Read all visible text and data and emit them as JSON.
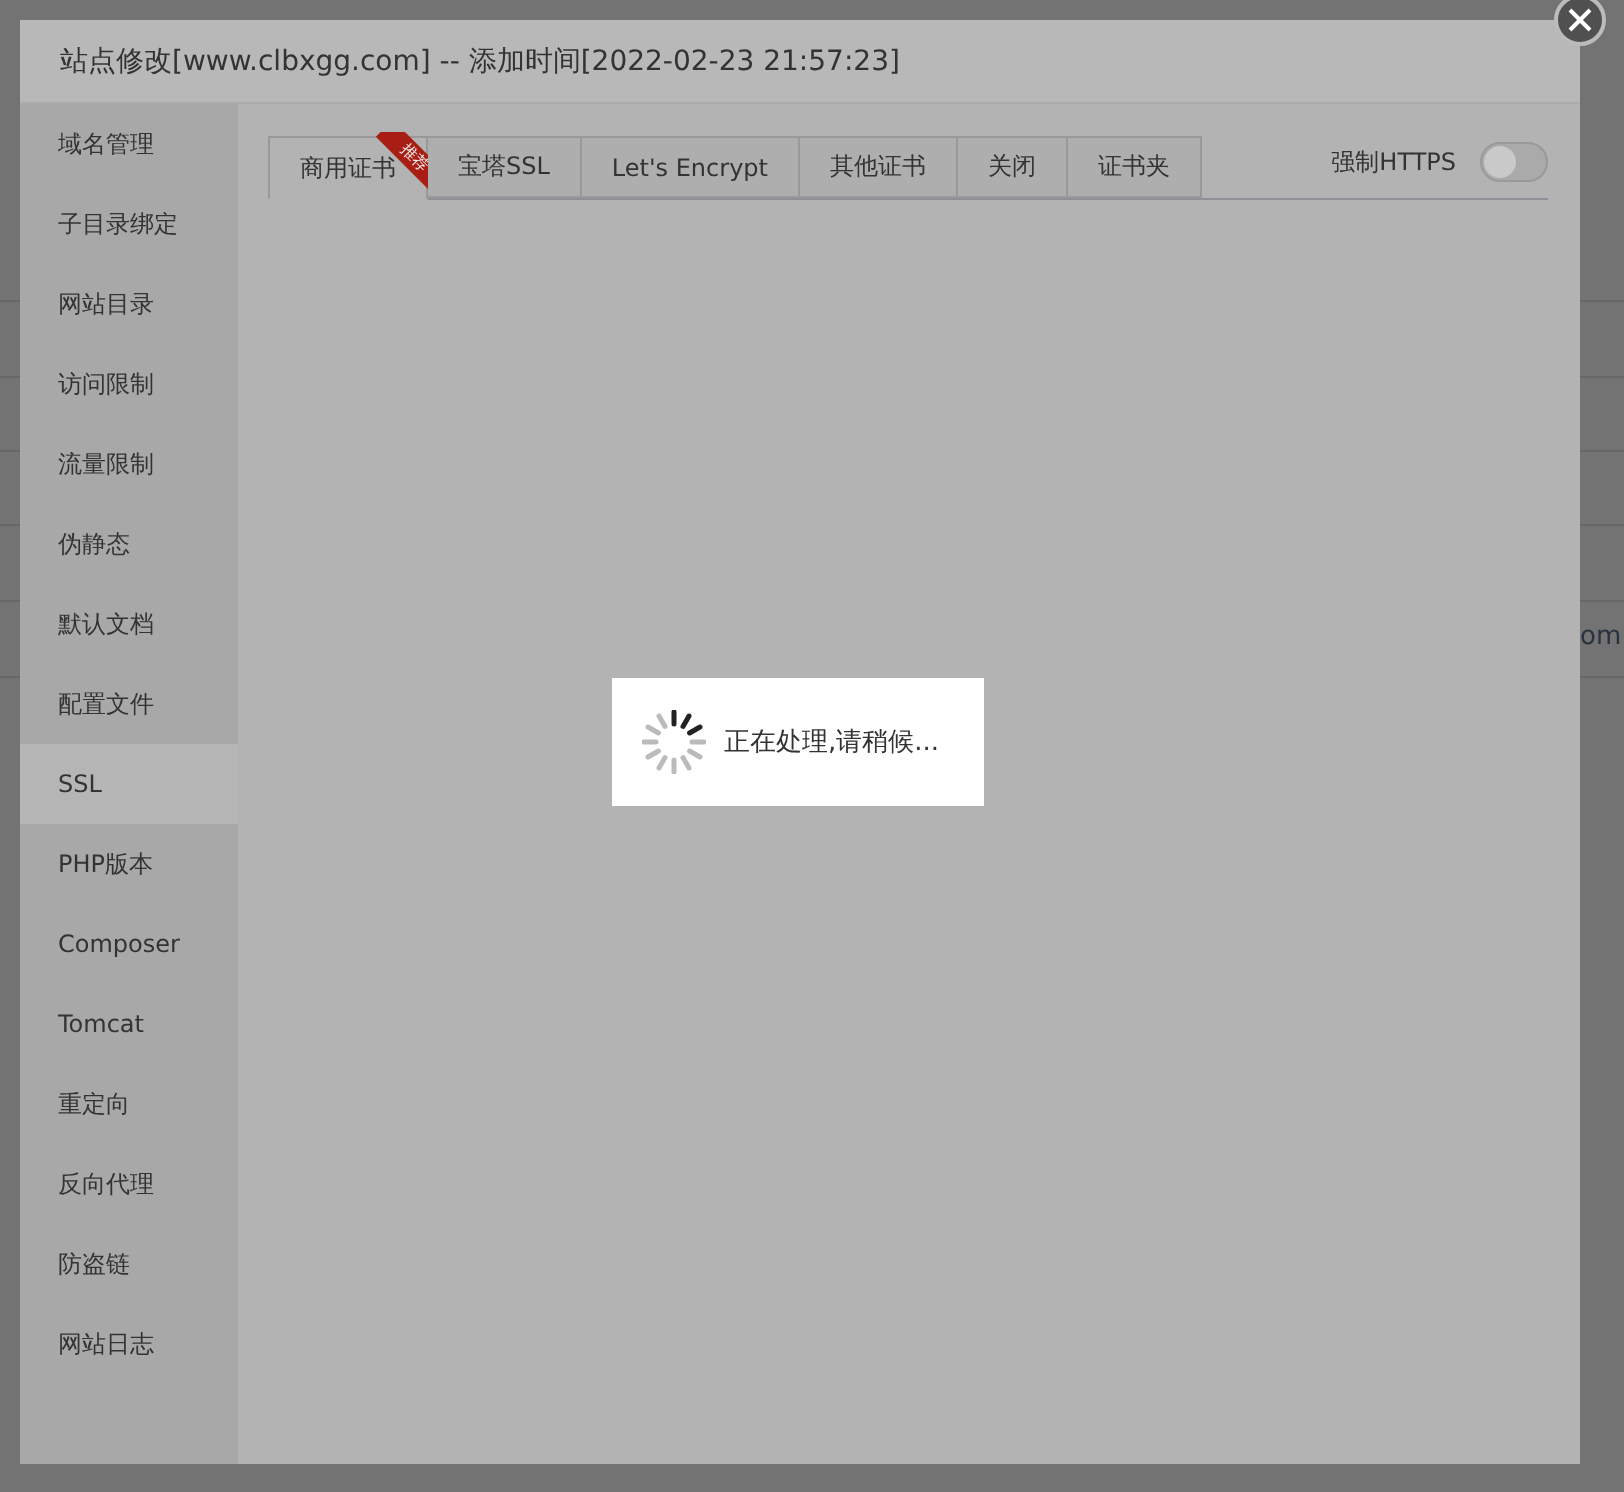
{
  "background": {
    "fragment": "om"
  },
  "dialog": {
    "title": "站点修改[www.clbxgg.com] -- 添加时间[2022-02-23 21:57:23]"
  },
  "sidebar": {
    "items": [
      {
        "label": "域名管理",
        "selected": false
      },
      {
        "label": "子目录绑定",
        "selected": false
      },
      {
        "label": "网站目录",
        "selected": false
      },
      {
        "label": "访问限制",
        "selected": false
      },
      {
        "label": "流量限制",
        "selected": false
      },
      {
        "label": "伪静态",
        "selected": false
      },
      {
        "label": "默认文档",
        "selected": false
      },
      {
        "label": "配置文件",
        "selected": false
      },
      {
        "label": "SSL",
        "selected": true
      },
      {
        "label": "PHP版本",
        "selected": false
      },
      {
        "label": "Composer",
        "selected": false
      },
      {
        "label": "Tomcat",
        "selected": false
      },
      {
        "label": "重定向",
        "selected": false
      },
      {
        "label": "反向代理",
        "selected": false
      },
      {
        "label": "防盗链",
        "selected": false
      },
      {
        "label": "网站日志",
        "selected": false
      }
    ]
  },
  "tabs": [
    {
      "label": "商用证书",
      "selected": true,
      "badge": "推荐"
    },
    {
      "label": "宝塔SSL",
      "selected": false
    },
    {
      "label": "Let's Encrypt",
      "selected": false
    },
    {
      "label": "其他证书",
      "selected": false
    },
    {
      "label": "关闭",
      "selected": false
    },
    {
      "label": "证书夹",
      "selected": false
    }
  ],
  "force_https": {
    "label": "强制HTTPS",
    "on": false
  },
  "loading": {
    "message": "正在处理,请稍候..."
  }
}
